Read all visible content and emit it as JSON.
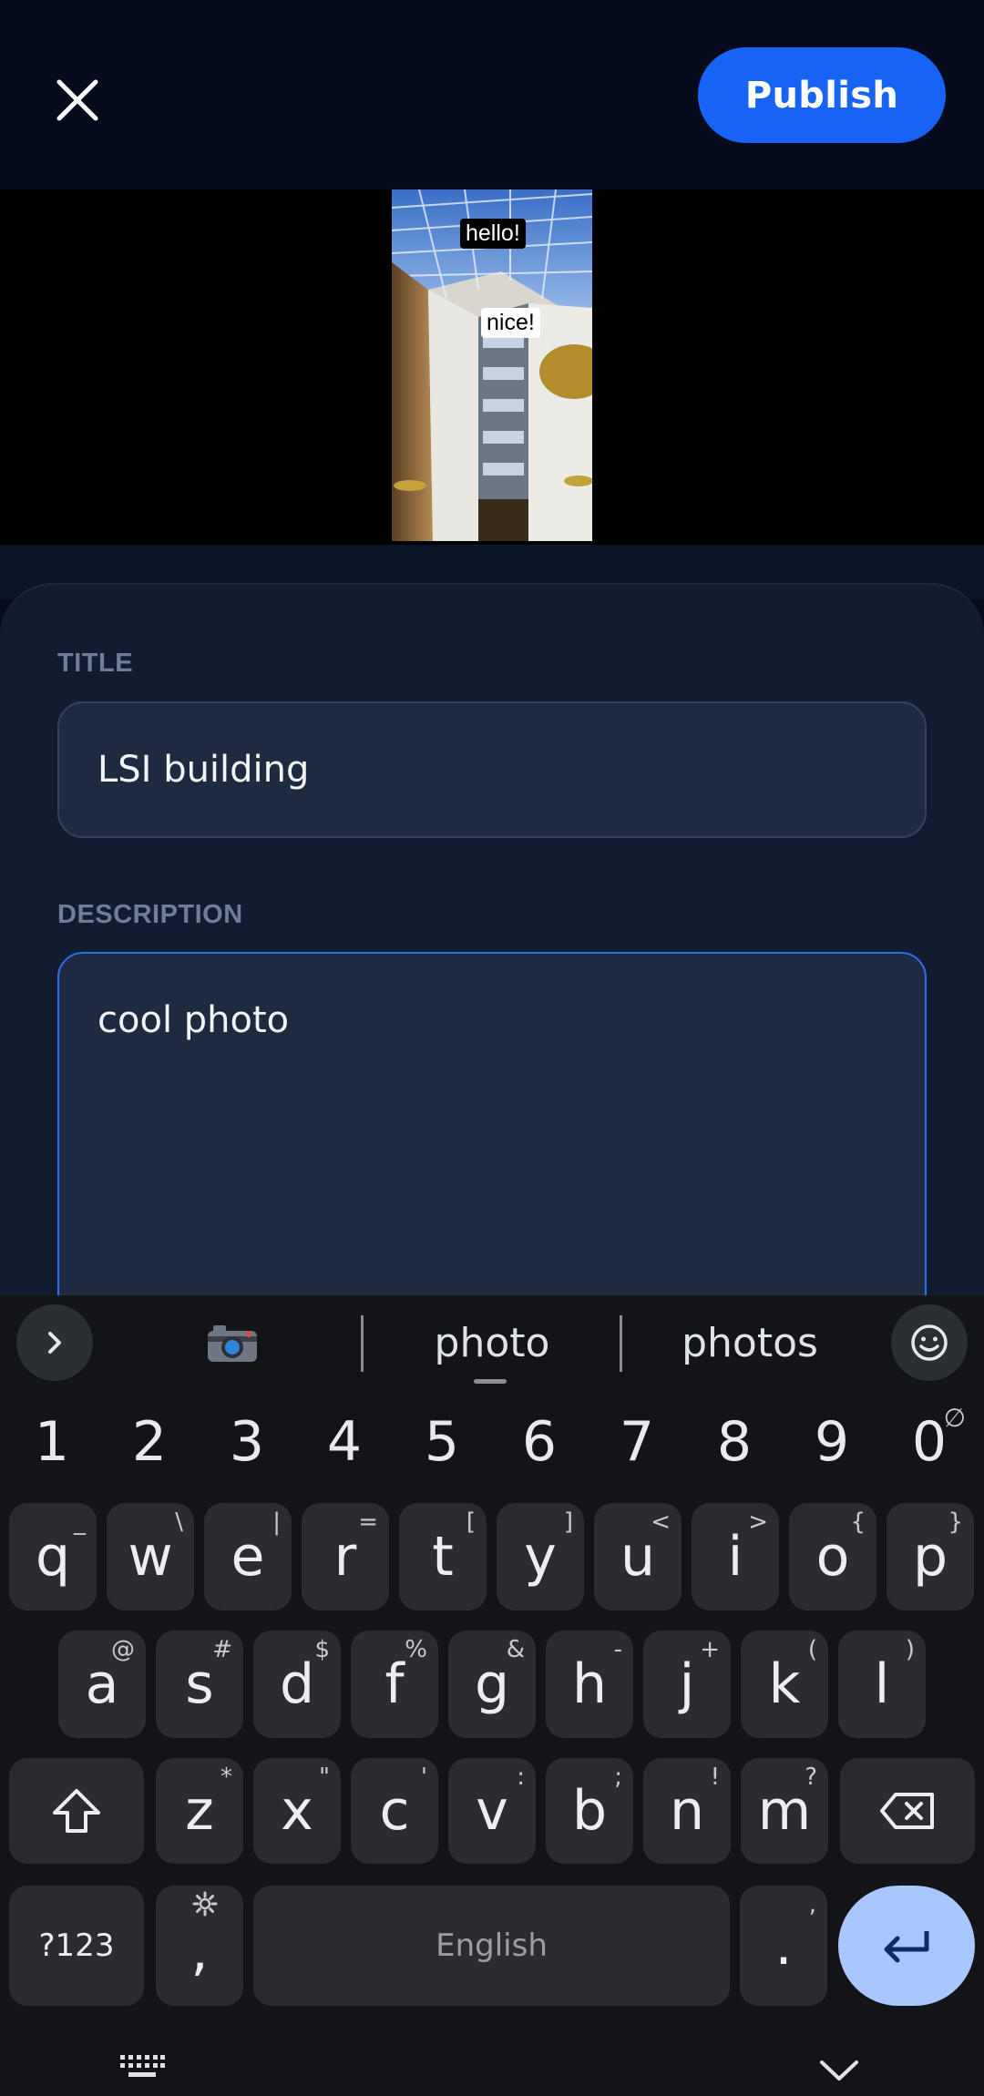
{
  "topbar": {
    "close_icon": "close-icon",
    "publish_label": "Publish"
  },
  "preview": {
    "stickers": [
      "hello!",
      "nice!"
    ]
  },
  "form": {
    "title_label": "TITLE",
    "title_value": "LSI building",
    "description_label": "DESCRIPTION",
    "description_value": "cool photo"
  },
  "keyboard": {
    "suggestions": [
      "photo",
      "photos"
    ],
    "camera_icon": "camera-emoji",
    "numbers": [
      "1",
      "2",
      "3",
      "4",
      "5",
      "6",
      "7",
      "8",
      "9",
      "0"
    ],
    "zero_alt": "∅",
    "row1": [
      {
        "k": "q",
        "a": "_"
      },
      {
        "k": "w",
        "a": "\\"
      },
      {
        "k": "e",
        "a": "|"
      },
      {
        "k": "r",
        "a": "="
      },
      {
        "k": "t",
        "a": "["
      },
      {
        "k": "y",
        "a": "]"
      },
      {
        "k": "u",
        "a": "<"
      },
      {
        "k": "i",
        "a": ">"
      },
      {
        "k": "o",
        "a": "{"
      },
      {
        "k": "p",
        "a": "}"
      }
    ],
    "row2": [
      {
        "k": "a",
        "a": "@"
      },
      {
        "k": "s",
        "a": "#"
      },
      {
        "k": "d",
        "a": "$"
      },
      {
        "k": "f",
        "a": "%"
      },
      {
        "k": "g",
        "a": "&"
      },
      {
        "k": "h",
        "a": "-"
      },
      {
        "k": "j",
        "a": "+"
      },
      {
        "k": "k",
        "a": "("
      },
      {
        "k": "l",
        "a": ")"
      }
    ],
    "row3": [
      {
        "k": "z",
        "a": "*"
      },
      {
        "k": "x",
        "a": "\""
      },
      {
        "k": "c",
        "a": "'"
      },
      {
        "k": "v",
        "a": ":"
      },
      {
        "k": "b",
        "a": ";"
      },
      {
        "k": "n",
        "a": "!"
      },
      {
        "k": "m",
        "a": "?"
      }
    ],
    "symbols_label": "?123",
    "comma": ",",
    "space_label": "English",
    "period": ".",
    "period_alt": ",",
    "accent_color": "#a8c6ff"
  }
}
